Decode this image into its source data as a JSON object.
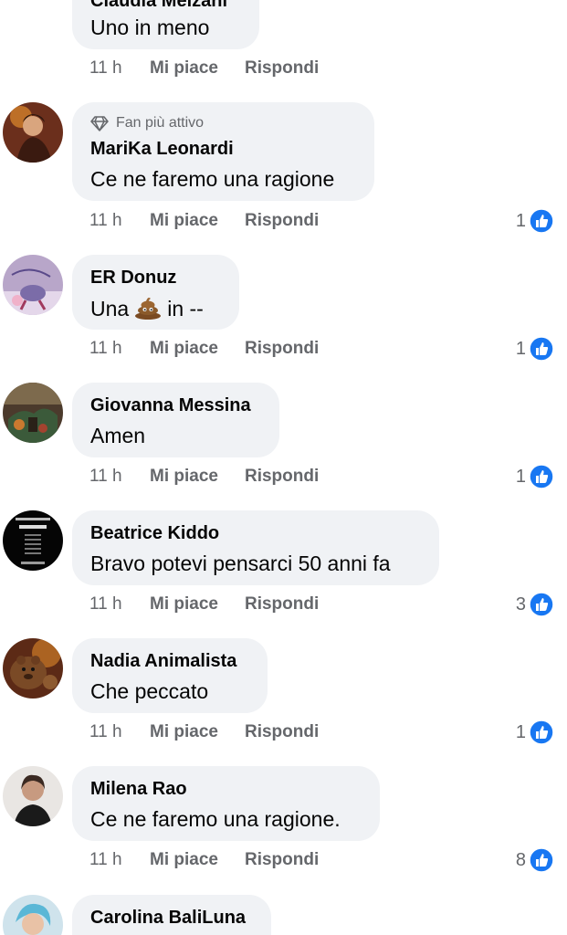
{
  "colors": {
    "bubble": "#f0f2f5",
    "meta_text": "#65676b",
    "like_blue": "#1877f2"
  },
  "comments": [
    {
      "author": "Claudia Melzani",
      "text": "Uno in meno",
      "time": "11 h",
      "like_label": "Mi piace",
      "reply_label": "Rispondi",
      "reactions": null,
      "badge": null,
      "avatar_icon": "profile-photo"
    },
    {
      "author": "MariKa Leonardi",
      "text": "Ce ne faremo una ragione",
      "time": "11 h",
      "like_label": "Mi piace",
      "reply_label": "Rispondi",
      "reactions": "1",
      "badge": "Fan più attivo",
      "badge_icon": "diamond-icon",
      "avatar_icon": "profile-photo"
    },
    {
      "author": "ER Donuz",
      "text_before": "Una",
      "emoji": "pile-of-poo",
      "text_after": "in --",
      "time": "11 h",
      "like_label": "Mi piace",
      "reply_label": "Rispondi",
      "reactions": "1",
      "avatar_icon": "profile-photo"
    },
    {
      "author": "Giovanna Messina",
      "text": "Amen",
      "time": "11 h",
      "like_label": "Mi piace",
      "reply_label": "Rispondi",
      "reactions": "1",
      "avatar_icon": "profile-photo"
    },
    {
      "author": "Beatrice Kiddo",
      "text": "Bravo potevi pensarci 50 anni fa",
      "time": "11 h",
      "like_label": "Mi piace",
      "reply_label": "Rispondi",
      "reactions": "3",
      "avatar_icon": "profile-photo"
    },
    {
      "author": "Nadia Animalista",
      "text": "Che peccato",
      "time": "11 h",
      "like_label": "Mi piace",
      "reply_label": "Rispondi",
      "reactions": "1",
      "avatar_icon": "profile-photo"
    },
    {
      "author": "Milena Rao",
      "text": "Ce ne faremo una ragione.",
      "time": "11 h",
      "like_label": "Mi piace",
      "reply_label": "Rispondi",
      "reactions": "8",
      "avatar_icon": "profile-photo"
    },
    {
      "author": "Carolina BaliLuna",
      "avatar_icon": "profile-photo"
    }
  ]
}
